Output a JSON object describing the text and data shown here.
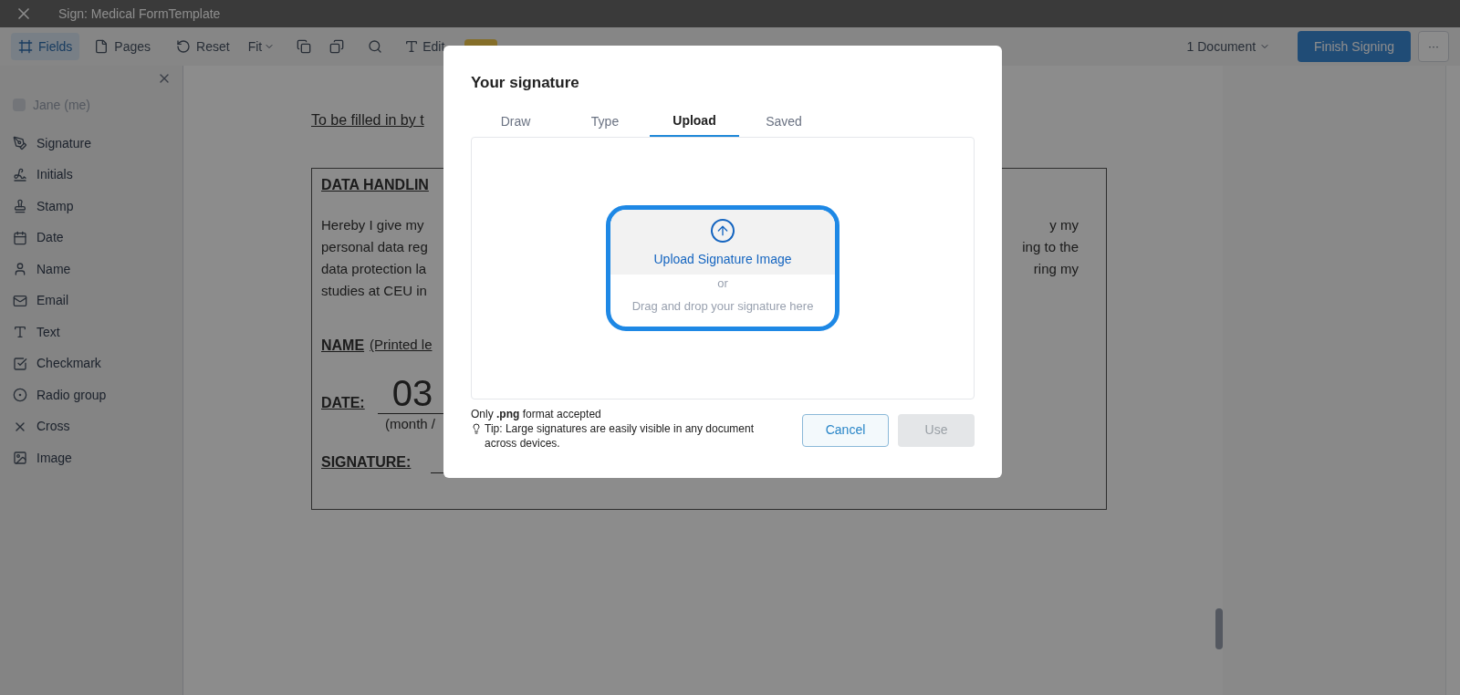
{
  "window": {
    "title": "Sign: Medical FormTemplate"
  },
  "toolbar": {
    "tabs": [
      {
        "label": "Fields",
        "selected": true
      },
      {
        "label": "Pages",
        "selected": false
      }
    ],
    "reset": "Reset",
    "fit": "Fit",
    "edit_text": "Edit",
    "documents": "1 Document",
    "finish": "Finish Signing",
    "more": "···"
  },
  "sidebar": {
    "signer": "Jane (me)",
    "fields": [
      {
        "label": "Signature",
        "kind": "signature"
      },
      {
        "label": "Initials",
        "kind": "initials"
      },
      {
        "label": "Stamp",
        "kind": "stamp"
      },
      {
        "label": "Date",
        "kind": "date"
      },
      {
        "label": "Name",
        "kind": "name"
      },
      {
        "label": "Email",
        "kind": "email"
      },
      {
        "label": "Text",
        "kind": "text"
      },
      {
        "label": "Checkmark",
        "kind": "checkmark"
      },
      {
        "label": "Radio group",
        "kind": "radio"
      },
      {
        "label": "Cross",
        "kind": "cross"
      },
      {
        "label": "Image",
        "kind": "image"
      }
    ]
  },
  "document": {
    "intro": "To be filled in by t",
    "heading": "DATA HANDLIN",
    "left_lines": [
      "Hereby I give my",
      "personal data reg",
      "data protection la",
      "studies at CEU in"
    ],
    "right_lines": [
      "y my",
      "ing to the",
      "ring my"
    ],
    "name_label": "NAME",
    "name_hint": "(Printed le",
    "date_label": "DATE:",
    "date_value": "03",
    "date_hint": "(month /",
    "signature_label": "SIGNATURE:"
  },
  "dialog": {
    "title": "Your signature",
    "tabs": [
      {
        "label": "Draw",
        "selected": false
      },
      {
        "label": "Type",
        "selected": false
      },
      {
        "label": "Upload",
        "selected": true
      },
      {
        "label": "Saved",
        "selected": false
      }
    ],
    "upload": {
      "button": "Upload Signature Image",
      "or": "or",
      "drop": "Drag and drop your signature here"
    },
    "format_note": "Only **.png** format accepted",
    "tip": "Tip: Large signatures are easily visible in any document across devices.",
    "cancel": "Cancel",
    "use": {
      "label": "Use",
      "disabled": true
    }
  }
}
